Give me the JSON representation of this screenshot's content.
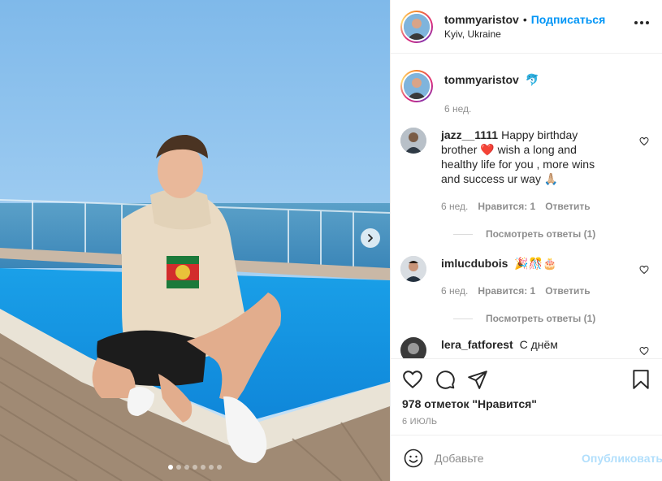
{
  "post": {
    "username": "tommyaristov",
    "separator": "•",
    "follow_label": "Подписаться",
    "location": "Kyiv, Ukraine",
    "more_icon": "more-horizontal-icon"
  },
  "caption": {
    "username": "tommyaristov",
    "text": "🐬",
    "time": "6 нед."
  },
  "comments": [
    {
      "username": "jazz__1111",
      "text": "Happy birthday brother ❤️ wish a long and healthy life for you , more wins and success ur way 🙏🏼",
      "time": "6 нед.",
      "likes": "Нравится: 1",
      "reply": "Ответить",
      "replies": "Посмотреть ответы (1)"
    },
    {
      "username": "imlucdubois",
      "text": "🎉🎊🎂",
      "time": "6 нед.",
      "likes": "Нравится: 1",
      "reply": "Ответить",
      "replies": "Посмотреть ответы (1)"
    },
    {
      "username": "lera_fatforest",
      "text": "С днём"
    }
  ],
  "stats": {
    "likes": "978 отметок \"Нравится\"",
    "date": "6 июль"
  },
  "composer": {
    "placeholder": "Добавьте",
    "publish_label": "Опубликовать"
  },
  "carousel": {
    "total": 7,
    "active": 1
  },
  "colors": {
    "accent": "#0095f6",
    "publish_disabled": "#b2dffc",
    "text": "#262626",
    "muted": "#8e8e8e"
  }
}
